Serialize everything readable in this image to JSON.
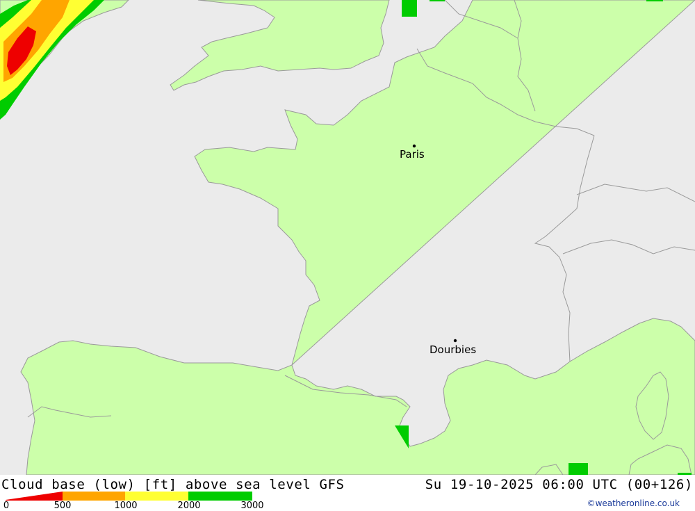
{
  "title": "Cloud base (low) [ft] above sea level GFS",
  "datetime": "Su 19-10-2025 06:00 UTC (00+126)",
  "credit": "©weatheronline.co.uk",
  "colors": {
    "sea": "#ebebeb",
    "land": "#ccffaa",
    "border": "#9a9a9a",
    "level_0_500": "#ee0000",
    "level_500_1000": "#ffa500",
    "level_1000_2000": "#ffff33",
    "level_2000_3000": "#00cc00"
  },
  "legend": {
    "ticks": [
      "0",
      "500",
      "1000",
      "2000",
      "3000"
    ]
  },
  "cities": [
    {
      "name": "Paris"
    },
    {
      "name": "Dourbies"
    }
  ]
}
